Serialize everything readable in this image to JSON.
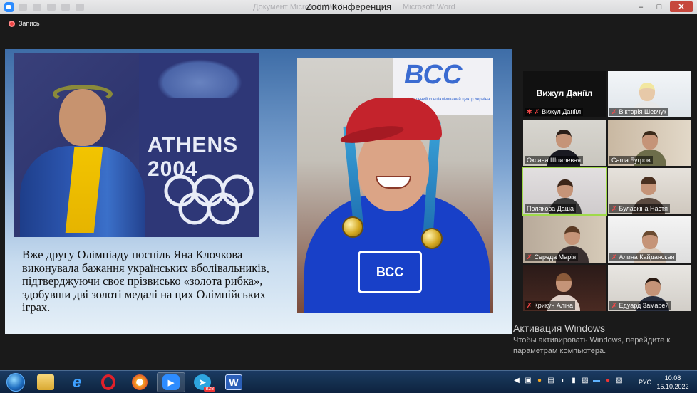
{
  "window": {
    "title": "Zoom Конференция",
    "ghost_title": "Документ Microsoft Word",
    "ghost_right": "Microsoft Word",
    "controls": {
      "minimize": "–",
      "maximize": "□",
      "close": "✕"
    }
  },
  "recording": {
    "label": "Запись"
  },
  "slide": {
    "photo1_text": "ATHENS 2004",
    "photo2_sign": "ВСС",
    "photo2_sign_small": "національний спеціалізований центр Україна",
    "photo2_shirt_logo": "ВСС",
    "paragraph": "Вже другу Олімпіаду поспіль Яна Клочкова виконувала бажання українських вболівальників, підтверджуючи своє прізвисько «золота рибка», здобувши дві золоті медалі на цих Олімпійських іграх."
  },
  "activation": {
    "title": "Активация Windows",
    "body": "Чтобы активировать Windows, перейдите к параметрам компьютера."
  },
  "participants": [
    {
      "name": "Вижул Даніїл",
      "display": "Вижул Даніїл",
      "muted": true,
      "pinned": true,
      "video": false
    },
    {
      "name": "Вікторія Шевчук",
      "muted": true,
      "video": true
    },
    {
      "name": "Оксана Шпилевая",
      "muted": false,
      "video": true
    },
    {
      "name": "Саша Бугров",
      "muted": false,
      "video": true
    },
    {
      "name": "Полякова Даша",
      "muted": false,
      "video": true,
      "active": true
    },
    {
      "name": "Булавкіна Настя",
      "muted": true,
      "video": true
    },
    {
      "name": "Середа Марія",
      "muted": true,
      "video": true
    },
    {
      "name": "Алина Кайданская",
      "muted": true,
      "video": true
    },
    {
      "name": "Крикун Аліна",
      "muted": true,
      "video": true
    },
    {
      "name": "Едуард Замарей",
      "muted": true,
      "video": true
    }
  ],
  "taskbar": {
    "items": [
      "start-orb",
      "explorer",
      "internet-explorer",
      "opera",
      "yandex",
      "zoom",
      "telegram",
      "word"
    ],
    "telegram_badge": "828",
    "language": "РУС",
    "time": "10:08",
    "date": "15.10.2022"
  },
  "colors": {
    "zoom_blue": "#2d8cff",
    "active_speaker": "#9fd94a",
    "muted_red": "#ff4a4a",
    "taskbar": "#14304f"
  }
}
